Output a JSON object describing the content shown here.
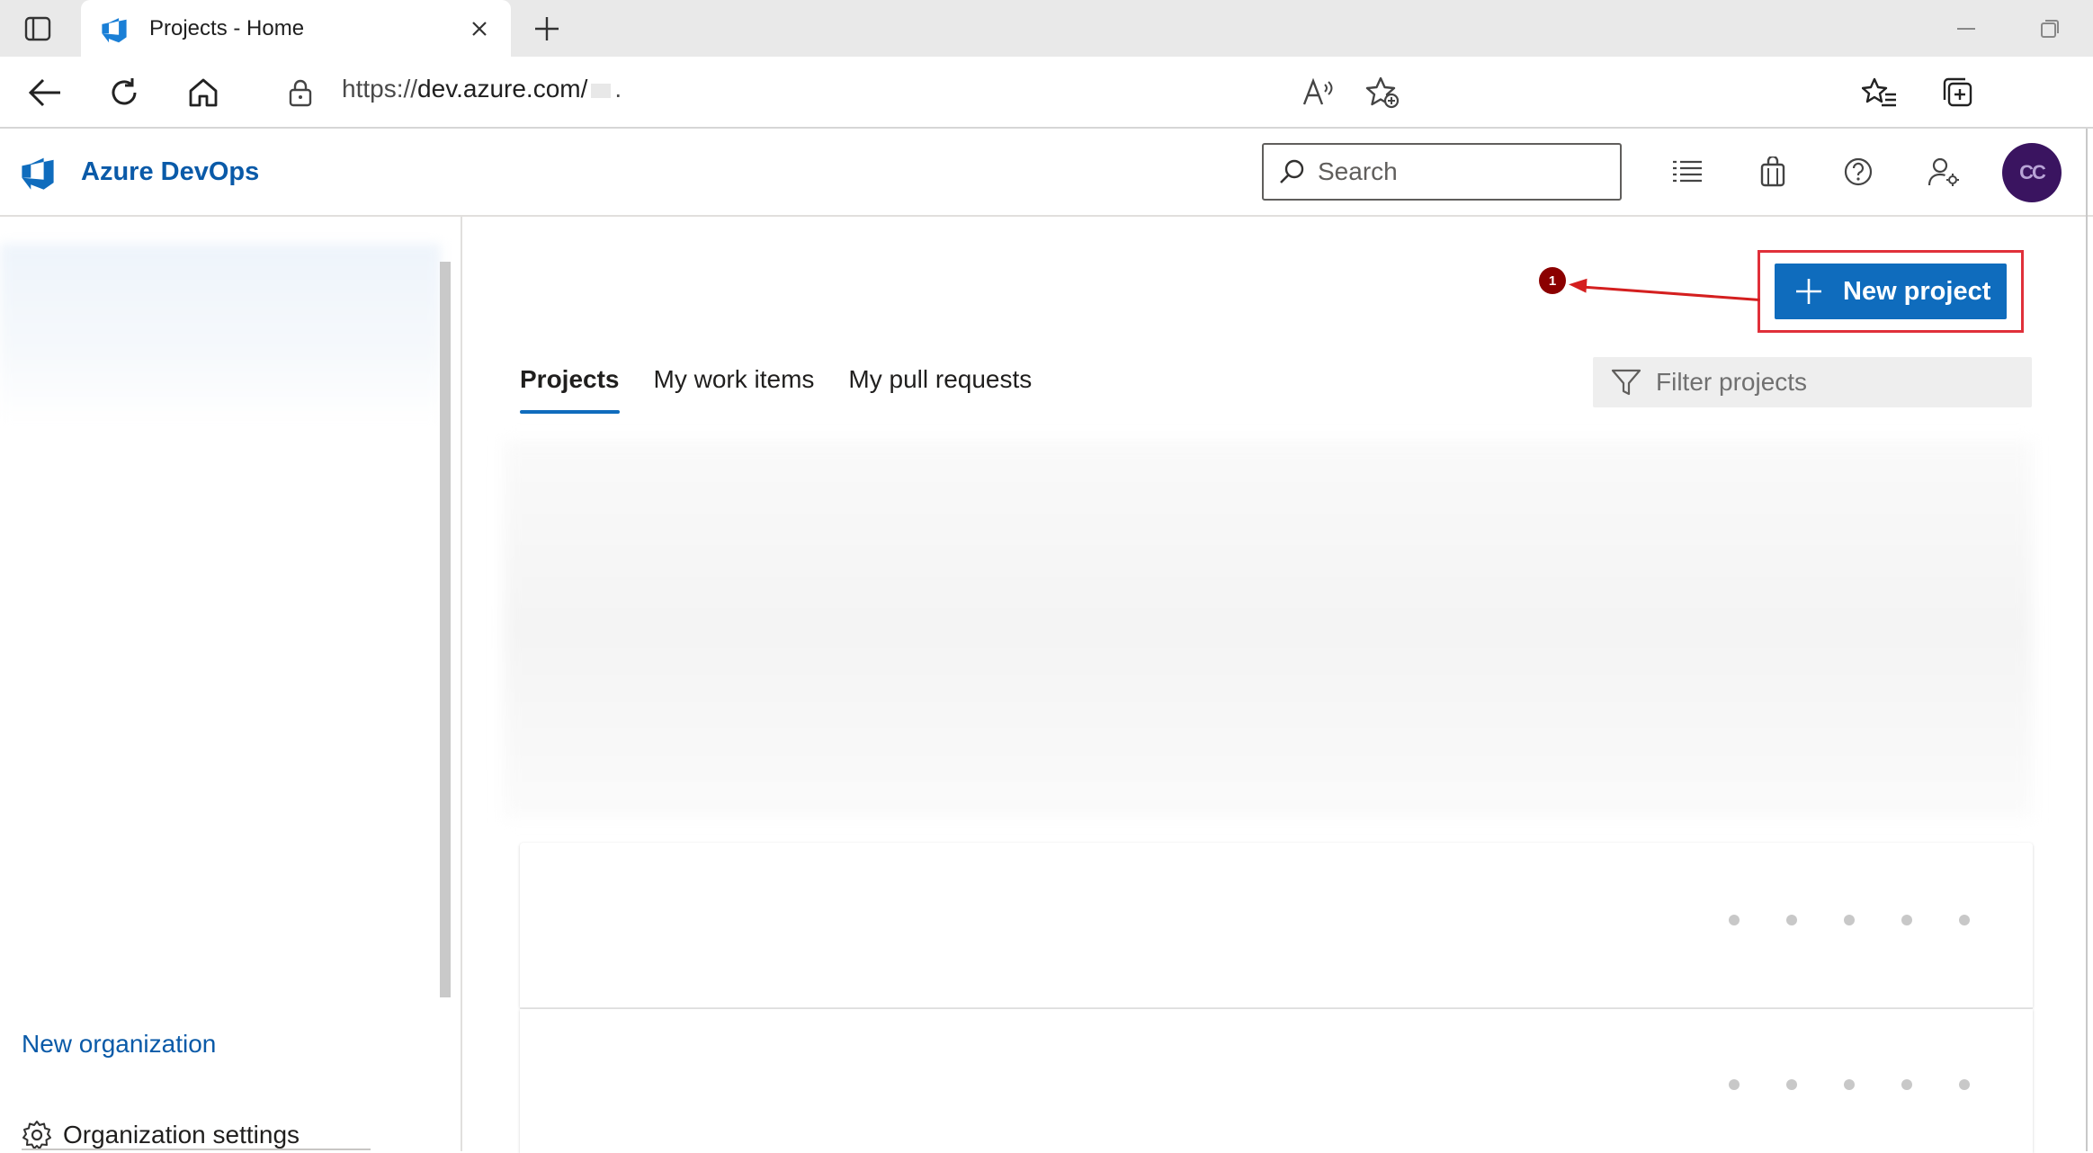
{
  "browser": {
    "tab_title": "Projects - Home",
    "url_prefix": "https://",
    "url_host": "dev.azure.com/",
    "url_suffix": "."
  },
  "header": {
    "brand": "Azure DevOps",
    "search_placeholder": "Search",
    "avatar_initials": "CC"
  },
  "sidebar": {
    "new_organization": "New organization",
    "organization_settings": "Organization settings"
  },
  "main": {
    "new_project_label": "New project",
    "tabs": [
      {
        "label": "Projects",
        "active": true
      },
      {
        "label": "My work items",
        "active": false
      },
      {
        "label": "My pull requests",
        "active": false
      }
    ],
    "filter_placeholder": "Filter projects"
  },
  "annotation": {
    "badge": "1"
  },
  "colors": {
    "accent": "#0f6cbd",
    "brand_text": "#0a5aa8",
    "annotation_red": "#e0303a",
    "avatar_bg": "#3a1460"
  }
}
